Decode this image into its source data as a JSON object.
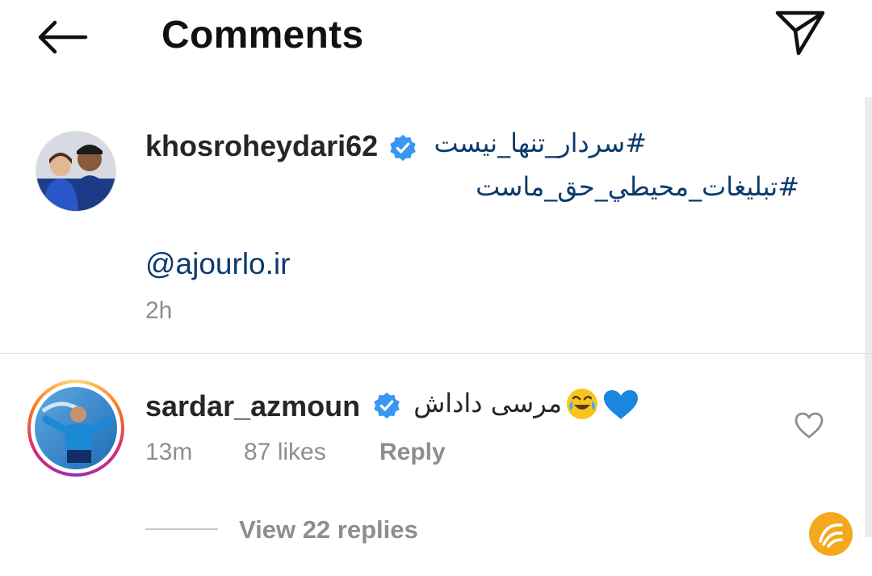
{
  "header": {
    "title": "Comments",
    "back_icon": "arrow-left-icon",
    "share_icon": "paper-plane-icon"
  },
  "caption": {
    "username": "khosroheydari62",
    "verified": true,
    "hashtag_line1": "#سردار_تنها_نیست",
    "hashtag_line2": "#تبلیغات_محیطي_حق_ماست",
    "mention": "@ajourlo.ir",
    "time": "2h"
  },
  "comment": {
    "username": "sardar_azmoun",
    "verified": true,
    "text": "مرسی داداش",
    "emojis": [
      "face-with-tears-of-joy",
      "blue-heart"
    ],
    "time": "13m",
    "likes": "87 likes",
    "reply_label": "Reply",
    "view_replies": "View 22 replies",
    "like_icon": "heart-outline-icon"
  },
  "colors": {
    "verified_blue": "#3897f0",
    "hashtag_text": "#0b3a6d",
    "meta_gray": "#8e8e8e",
    "heart_blue": "#1b86e0",
    "emoji_yellow": "#f8c51c",
    "watermark_orange": "#f4a81d"
  }
}
